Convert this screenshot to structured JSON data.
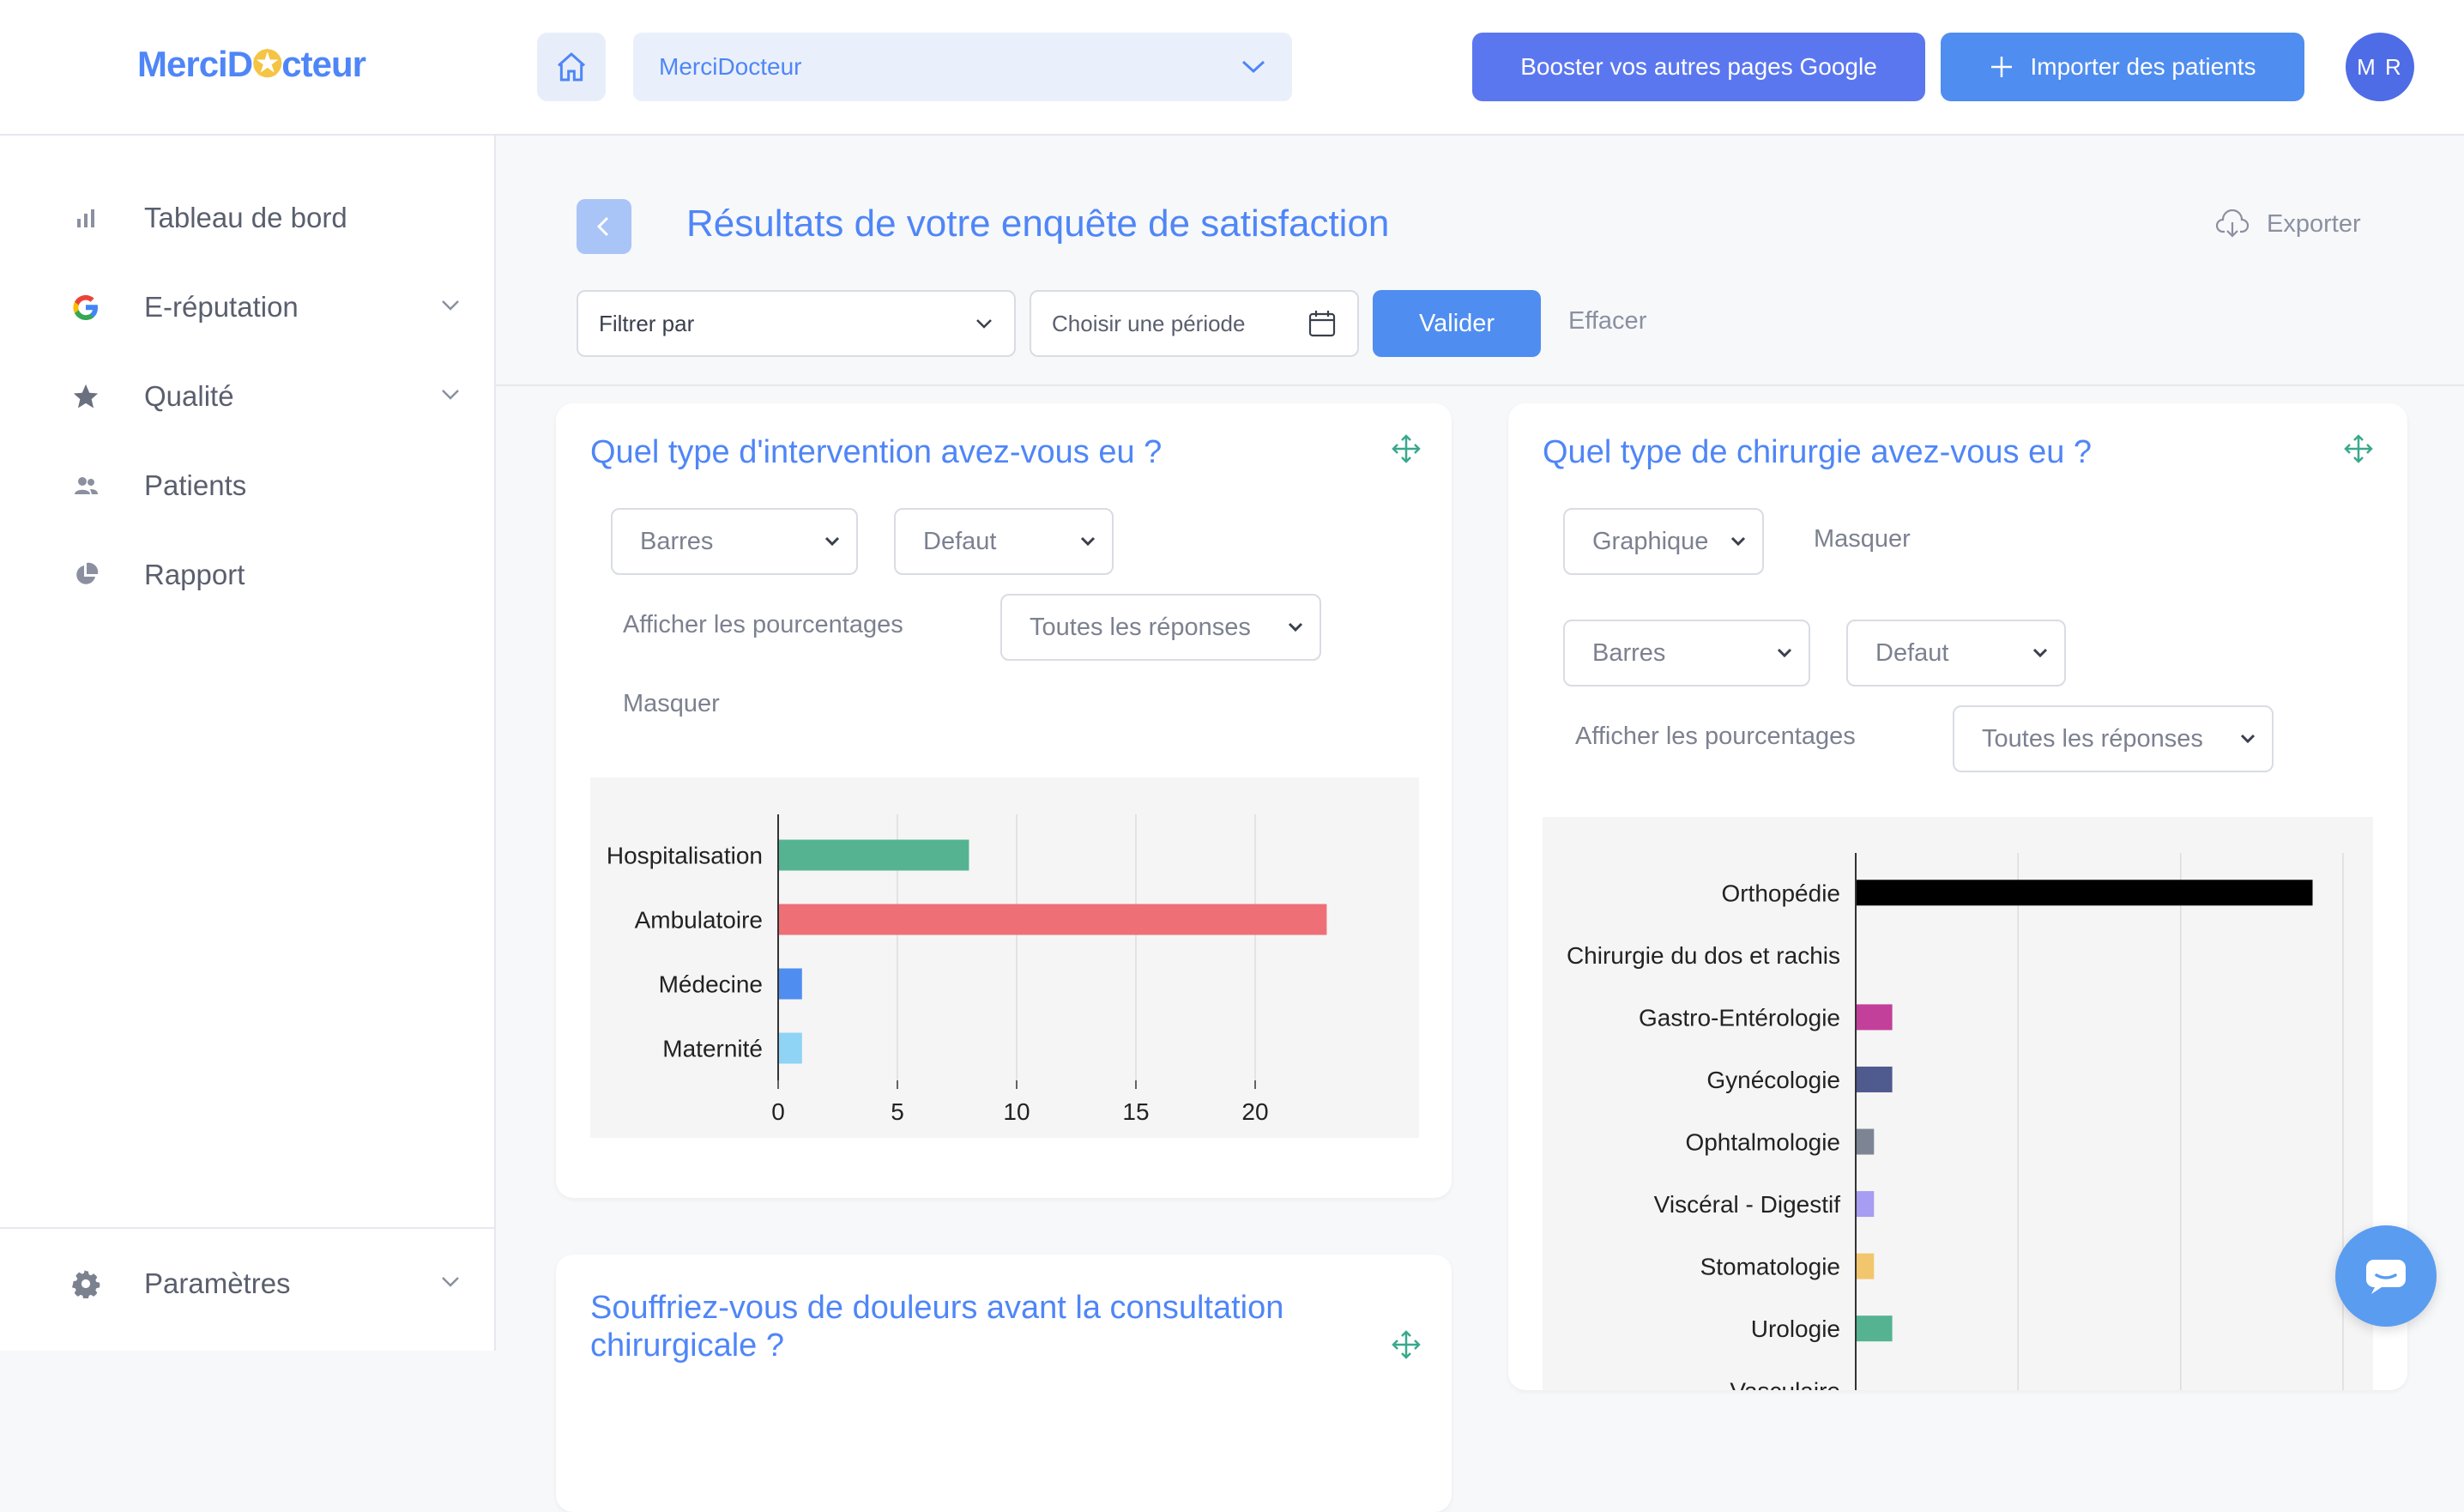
{
  "header": {
    "logo_prefix": "MerciD",
    "logo_star": "✪",
    "logo_suffix": "cteur",
    "site_select": "MerciDocteur",
    "boost_label": "Booster vos autres pages Google",
    "import_label": "Importer des patients",
    "avatar": "M R"
  },
  "sidebar": {
    "items": [
      {
        "label": "Tableau de bord",
        "icon": "bar-chart-icon"
      },
      {
        "label": "E-réputation",
        "icon": "google-icon"
      },
      {
        "label": "Qualité",
        "icon": "star-icon"
      },
      {
        "label": "Patients",
        "icon": "users-icon"
      },
      {
        "label": "Rapport",
        "icon": "pie-chart-icon"
      }
    ],
    "settings": {
      "label": "Paramètres",
      "icon": "gear-icon"
    }
  },
  "page": {
    "title": "Résultats de votre enquête de satisfaction",
    "export_label": "Exporter",
    "filter_label": "Filtrer par",
    "period_placeholder": "Choisir une période",
    "validate_label": "Valider",
    "clear_label": "Effacer"
  },
  "card1": {
    "title": "Quel type d'intervention avez-vous eu ?",
    "chart_type_select": "Barres",
    "style_select": "Defaut",
    "show_percent_label": "Afficher les pourcentages",
    "responses_select": "Toutes les réponses",
    "hide_label": "Masquer"
  },
  "card2": {
    "title": "Quel type de chirurgie avez-vous eu ?",
    "display_select": "Graphique",
    "hide_label": "Masquer",
    "chart_type_select": "Barres",
    "style_select": "Defaut",
    "show_percent_label": "Afficher les pourcentages",
    "responses_select": "Toutes les réponses"
  },
  "card3": {
    "title": "Souffriez-vous de douleurs avant la consultation chirurgicale ?"
  },
  "colors": {
    "accent": "#4f86f7",
    "primary_button": "#4f8df0",
    "boost_button": "#5b77f0"
  },
  "chart_data": [
    {
      "type": "bar",
      "orientation": "horizontal",
      "categories": [
        "Hospitalisation",
        "Ambulatoire",
        "Médecine",
        "Maternité"
      ],
      "values": [
        8,
        23,
        1,
        1
      ],
      "colors": [
        "#55b391",
        "#ef6f77",
        "#4f8df0",
        "#8fd3f5"
      ],
      "xlim": [
        0,
        25
      ],
      "xticks": [
        0,
        5,
        10,
        15,
        20
      ],
      "grid": true
    },
    {
      "type": "bar",
      "orientation": "horizontal",
      "categories": [
        "Orthopédie",
        "Chirurgie du dos et rachis",
        "Gastro-Entérologie",
        "Gynécologie",
        "Ophtalmologie",
        "Viscéral - Digestif",
        "Stomatologie",
        "Urologie",
        "Vasculaire"
      ],
      "values": [
        15,
        0,
        1.2,
        1.2,
        0.6,
        0.6,
        0.6,
        1.2,
        0
      ],
      "colors": [
        "#000000",
        "#888888",
        "#c2409a",
        "#4f5a8f",
        "#7d8595",
        "#a79df2",
        "#f2c66d",
        "#55b391",
        "#888888"
      ],
      "xlim": [
        0,
        16
      ],
      "grid": true
    }
  ]
}
